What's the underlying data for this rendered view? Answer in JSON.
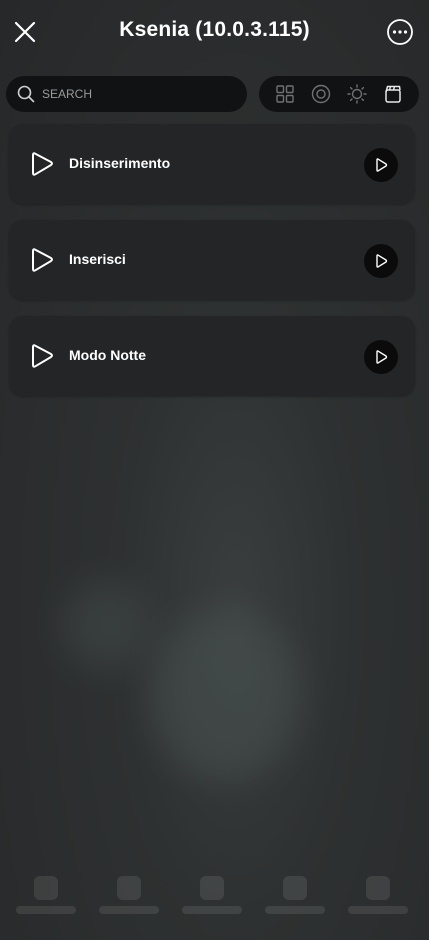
{
  "header": {
    "title": "Ksenia (10.0.3.115)",
    "close_icon": "close-icon",
    "more_icon": "more-options-icon"
  },
  "search": {
    "placeholder": "SEARCH",
    "value": ""
  },
  "filters": [
    {
      "icon": "grid-icon"
    },
    {
      "icon": "circle-target-icon"
    },
    {
      "icon": "sun-icon"
    },
    {
      "icon": "scene-clapper-icon"
    }
  ],
  "scenarios": [
    {
      "label": "Disinserimento"
    },
    {
      "label": "Inserisci"
    },
    {
      "label": "Modo Notte"
    }
  ],
  "colors": {
    "background": "#2b2d2e",
    "card": "#242526",
    "pill": "#111213"
  }
}
